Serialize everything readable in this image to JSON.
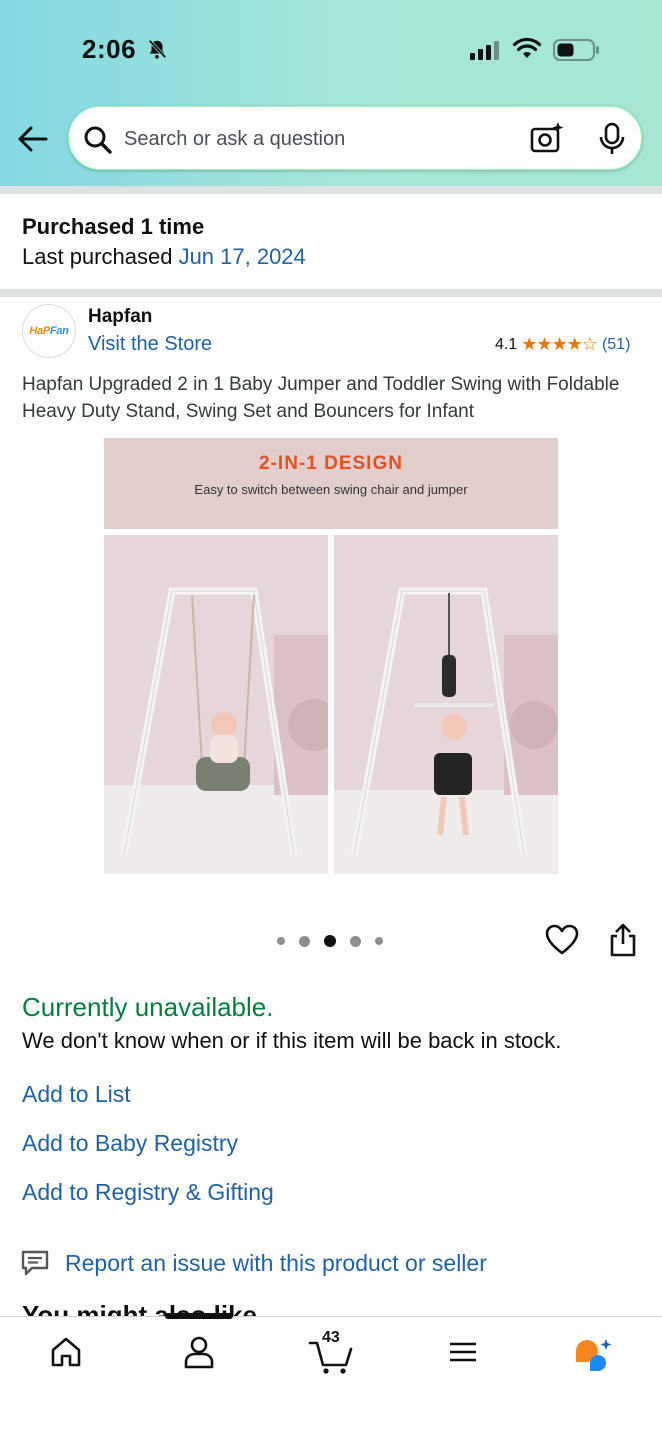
{
  "status_bar": {
    "time": "2:06",
    "icons": [
      "bell-slash-icon",
      "signal-icon",
      "wifi-icon",
      "battery-icon"
    ]
  },
  "search": {
    "placeholder": "Search or ask a question",
    "icons": [
      "back-arrow-icon",
      "search-icon",
      "camera-sparkle-icon",
      "microphone-icon"
    ]
  },
  "purchase": {
    "title": "Purchased 1 time",
    "last_label": "Last purchased",
    "last_date": "Jun 17, 2024"
  },
  "brand": {
    "logo_text_a": "HaP",
    "logo_text_b": "Fan",
    "name": "Hapfan",
    "visit": "Visit the Store",
    "rating": "4.1",
    "rating_value": 4.1,
    "stars": "★★★★☆",
    "reviews": "(51)",
    "colors": {
      "star": "#e67a00",
      "link": "#2162a1"
    }
  },
  "product": {
    "title": "Hapfan Upgraded 2 in 1 Baby Jumper and Toddler Swing with Foldable Heavy Duty Stand, Swing Set and Bouncers for Infant",
    "image": {
      "banner_title": "2-IN-1 DESIGN",
      "banner_subtitle": "Easy to switch between swing chair and jumper"
    },
    "carousel": {
      "count": 5,
      "active_index": 2
    },
    "actions": [
      "heart-icon",
      "share-icon"
    ]
  },
  "availability": {
    "status": "Currently unavailable.",
    "message": "We don't know when or if this item will be back in stock.",
    "status_color": "#067d3f"
  },
  "links": {
    "add_list": "Add to List",
    "add_baby_registry": "Add to Baby Registry",
    "add_registry_gifting": "Add to Registry & Gifting",
    "report": "Report an issue with this product or seller"
  },
  "section": {
    "you_might_like": "You might also like"
  },
  "bottom_nav": {
    "items": [
      "home-icon",
      "account-icon",
      "cart-icon",
      "menu-icon",
      "rufus-icon"
    ],
    "cart_count": "43"
  }
}
